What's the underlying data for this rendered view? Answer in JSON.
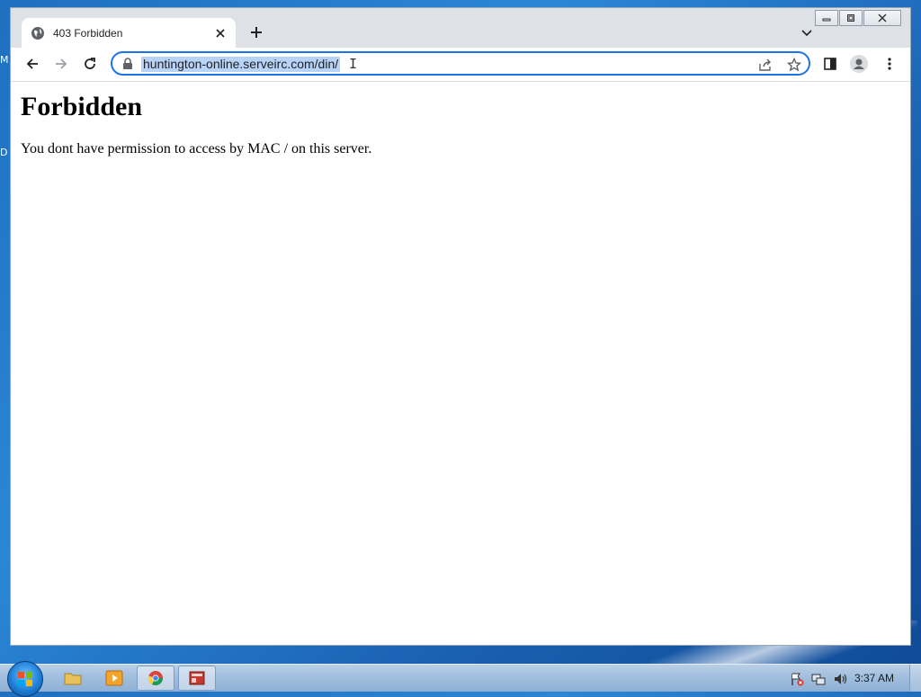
{
  "tab": {
    "title": "403 Forbidden"
  },
  "omnibox": {
    "url": "huntington-online.serveirc.com/din/"
  },
  "page": {
    "heading": "Forbidden",
    "message": "You dont have permission to access by MAC / on this server."
  },
  "taskbar": {
    "clock": "3:37 AM"
  },
  "desktop": {
    "letters": [
      "M",
      "D"
    ]
  },
  "colors": {
    "accent": "#1a73e8",
    "selection": "#b7d3f7",
    "tabstrip": "#dee1e6"
  }
}
